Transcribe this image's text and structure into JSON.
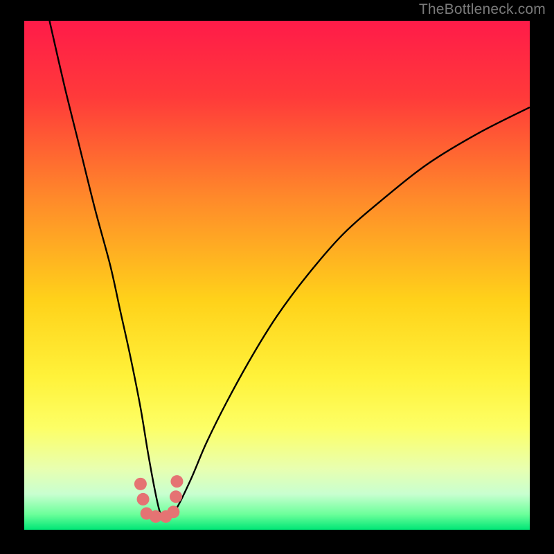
{
  "watermark": "TheBottleneck.com",
  "chart_data": {
    "type": "line",
    "title": "",
    "xlabel": "",
    "ylabel": "",
    "xlim": [
      0,
      100
    ],
    "ylim": [
      0,
      100
    ],
    "background_gradient": {
      "stops": [
        {
          "offset": 0.0,
          "color": "#ff1b49"
        },
        {
          "offset": 0.15,
          "color": "#ff3a3a"
        },
        {
          "offset": 0.35,
          "color": "#ff8a2a"
        },
        {
          "offset": 0.55,
          "color": "#ffd21a"
        },
        {
          "offset": 0.7,
          "color": "#fff23a"
        },
        {
          "offset": 0.8,
          "color": "#fdff66"
        },
        {
          "offset": 0.88,
          "color": "#e8ffb0"
        },
        {
          "offset": 0.93,
          "color": "#c8ffd0"
        },
        {
          "offset": 0.97,
          "color": "#6bff9a"
        },
        {
          "offset": 1.0,
          "color": "#00e676"
        }
      ]
    },
    "series": [
      {
        "name": "bottleneck-curve",
        "color": "#000000",
        "x": [
          5,
          8,
          11,
          14,
          17,
          19,
          21,
          23,
          24.5,
          26,
          27,
          28,
          30,
          33,
          36,
          40,
          45,
          50,
          56,
          63,
          71,
          80,
          90,
          100
        ],
        "values": [
          100,
          87,
          75,
          63,
          52,
          43,
          34,
          24,
          15,
          7,
          3,
          2.5,
          4,
          10,
          17,
          25,
          34,
          42,
          50,
          58,
          65,
          72,
          78,
          83
        ]
      }
    ],
    "markers": {
      "name": "bottleneck-markers",
      "color": "#e57373",
      "points": [
        {
          "x": 23.0,
          "y": 9.0
        },
        {
          "x": 23.5,
          "y": 6.0
        },
        {
          "x": 24.2,
          "y": 3.2
        },
        {
          "x": 26.0,
          "y": 2.6
        },
        {
          "x": 28.0,
          "y": 2.6
        },
        {
          "x": 29.5,
          "y": 3.5
        },
        {
          "x": 30.0,
          "y": 6.5
        },
        {
          "x": 30.2,
          "y": 9.5
        }
      ],
      "radius_px": 9
    }
  }
}
